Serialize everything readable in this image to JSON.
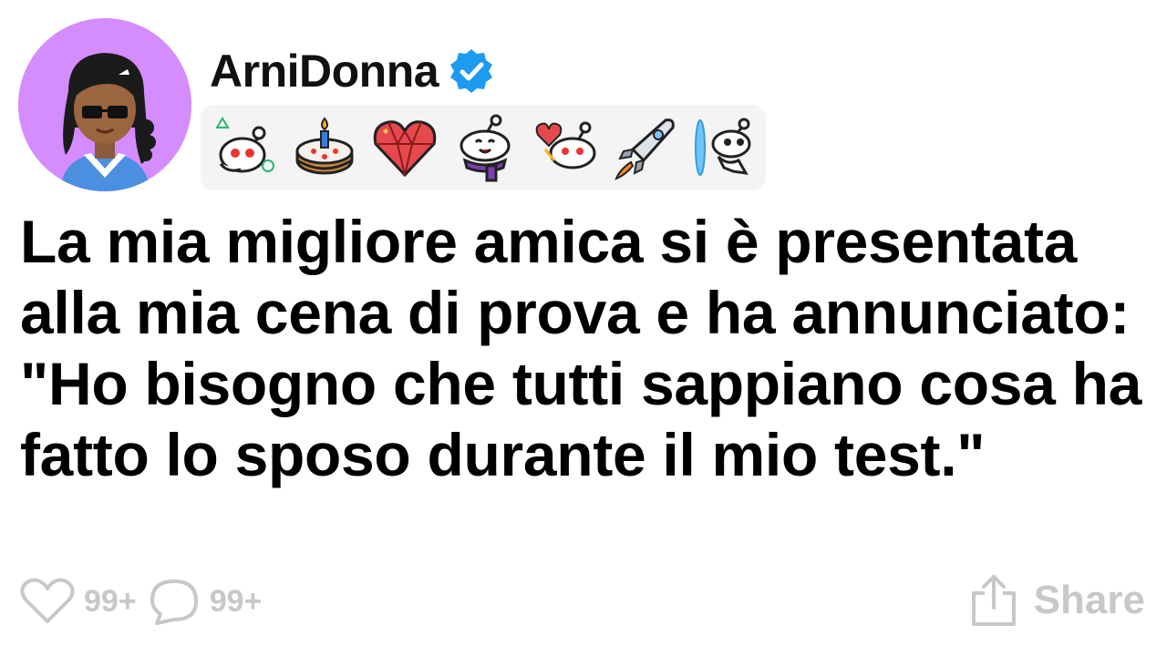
{
  "post": {
    "username": "ArniDonna",
    "title": "La mia migliore amica si è presentata alla mia cena di prova e ha annunciato: \"Ho bisogno che tutti sappiano cosa ha fatto lo sposo durante il mio test.\"",
    "avatar_color": "#d48cff",
    "verified_color": "#1d9bf0"
  },
  "awards": [
    {
      "icon": "alien-shapes-award-icon"
    },
    {
      "icon": "birthday-cake-award-icon"
    },
    {
      "icon": "gem-heart-award-icon"
    },
    {
      "icon": "scarf-snoo-award-icon"
    },
    {
      "icon": "heart-snoo-award-icon"
    },
    {
      "icon": "rocket-award-icon"
    },
    {
      "icon": "portal-snoo-award-icon"
    }
  ],
  "actions": {
    "likes": "99+",
    "comments": "99+",
    "share_label": "Share"
  }
}
